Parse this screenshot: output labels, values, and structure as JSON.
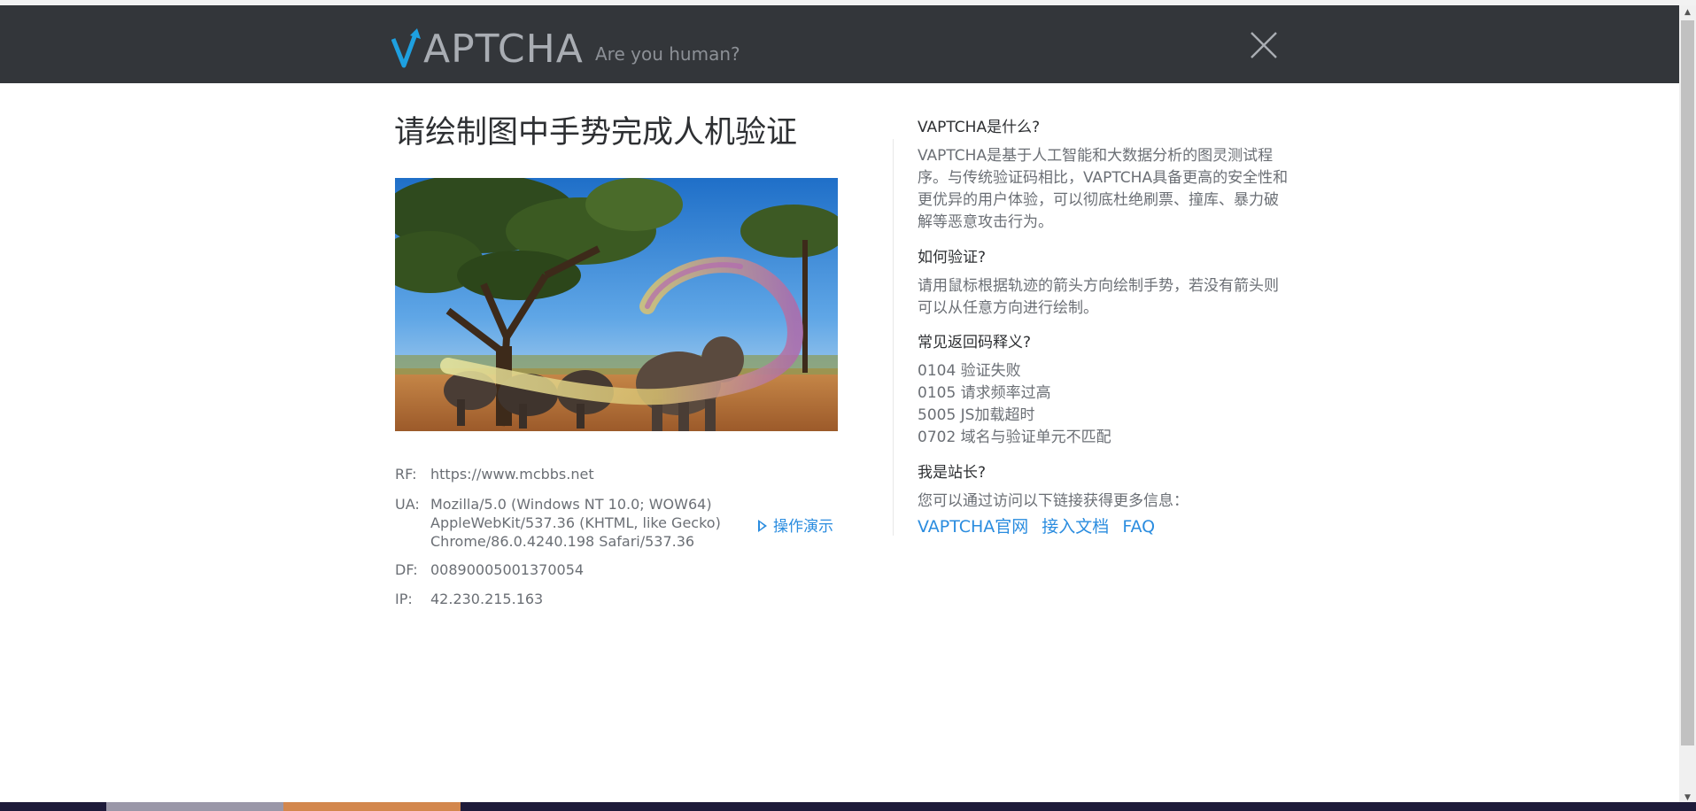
{
  "header": {
    "logo_text": "APTCHA",
    "tagline": "Are you human?",
    "colors": {
      "background": "#33363a",
      "logo_accent": "#1ea0e0"
    }
  },
  "main": {
    "title": "请绘制图中手势完成人机验证",
    "info": [
      {
        "key": "RF:",
        "value": "https://www.mcbbs.net"
      },
      {
        "key": "UA:",
        "value": "Mozilla/5.0 (Windows NT 10.0; WOW64) AppleWebKit/537.36 (KHTML, like Gecko) Chrome/86.0.4240.198 Safari/537.36"
      },
      {
        "key": "DF:",
        "value": "00890005001370054"
      },
      {
        "key": "IP:",
        "value": "42.230.215.163"
      }
    ],
    "demo_link": "操作演示"
  },
  "sidebar": {
    "q1": "VAPTCHA是什么?",
    "a1": "VAPTCHA是基于人工智能和大数据分析的图灵测试程序。与传统验证码相比，VAPTCHA具备更高的安全性和更优异的用户体验，可以彻底杜绝刷票、撞库、暴力破解等恶意攻击行为。",
    "q2": "如何验证?",
    "a2": "请用鼠标根据轨迹的箭头方向绘制手势，若没有箭头则可以从任意方向进行绘制。",
    "q3": "常见返回码释义?",
    "codes": [
      "0104 验证失败",
      "0105 请求频率过高",
      "5005 JS加载超时",
      "0702 域名与验证单元不匹配"
    ],
    "q4": "我是站长?",
    "a4": "您可以通过访问以下链接获得更多信息：",
    "links": [
      "VAPTCHA官网",
      "接入文档",
      "FAQ"
    ]
  },
  "icons": {
    "close": "close-icon",
    "refresh": "refresh-icon",
    "demo": "play-triangle-icon"
  },
  "colors": {
    "link": "#2a8cdf",
    "text_dark": "#2e3033",
    "text_muted": "#6b6f75"
  }
}
